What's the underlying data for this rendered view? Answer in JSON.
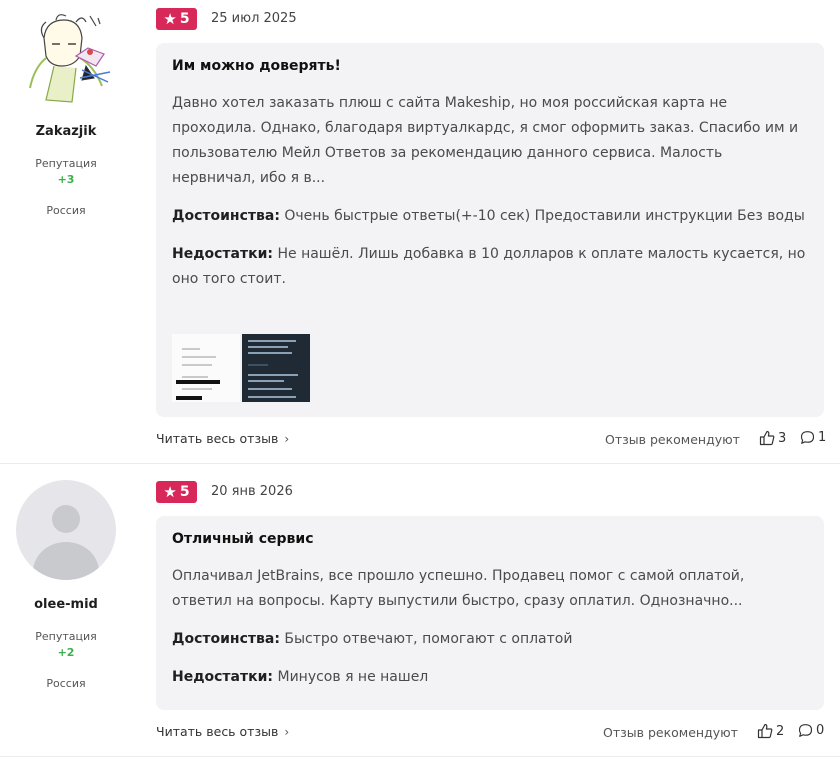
{
  "reviews": [
    {
      "author": {
        "nickname": "Zakazjik",
        "reputation_label": "Репутация",
        "reputation_value": "+3",
        "country": "Россия"
      },
      "rating": "5",
      "date": "25 июл 2025",
      "title": "Им можно доверять!",
      "text": "Давно хотел заказать плюш с сайта Makeship, но моя российская карта не проходила. Однако, благодаря виртуалкардс, я смог оформить заказ. Спасибо им и пользователю Мейл Ответов за рекомендацию данного сервиса. Малость нервничал, ибо я в...",
      "pros_label": "Достоинства:",
      "pros": "Очень быстрые ответы(+-10 сек) Предоставили инструкции Без воды",
      "cons_label": "Недостатки:",
      "cons": "Не нашёл. Лишь добавка в 10 долларов к оплате малость кусается, но оно того стоит.",
      "read_full": "Читать весь отзыв",
      "recommend_label": "Отзыв рекомендуют",
      "likes": "3",
      "comments": "1"
    },
    {
      "author": {
        "nickname": "olee-mid",
        "reputation_label": "Репутация",
        "reputation_value": "+2",
        "country": "Россия"
      },
      "rating": "5",
      "date": "20 янв 2026",
      "title": "Отличный сервис",
      "text": "Оплачивал JetBrains, все прошло успешно. Продавец помог с самой оплатой, ответил на вопросы. Карту выпустили быстро, сразу оплатил. Однозначно...",
      "pros_label": "Достоинства:",
      "pros": "Быстро отвечают, помогают с оплатой",
      "cons_label": "Недостатки:",
      "cons": "Минусов я не нашел",
      "read_full": "Читать весь отзыв",
      "recommend_label": "Отзыв рекомендуют",
      "likes": "2",
      "comments": "0"
    }
  ],
  "icons": {
    "star": "star-icon",
    "chevron": "chevron-right-icon",
    "like": "thumbs-up-icon",
    "comment": "comment-icon",
    "avatar_default": "default-avatar-icon"
  },
  "colors": {
    "rating_badge": "#d8285a",
    "reputation_positive": "#3bb04a",
    "card_background": "#f3f3f5"
  }
}
